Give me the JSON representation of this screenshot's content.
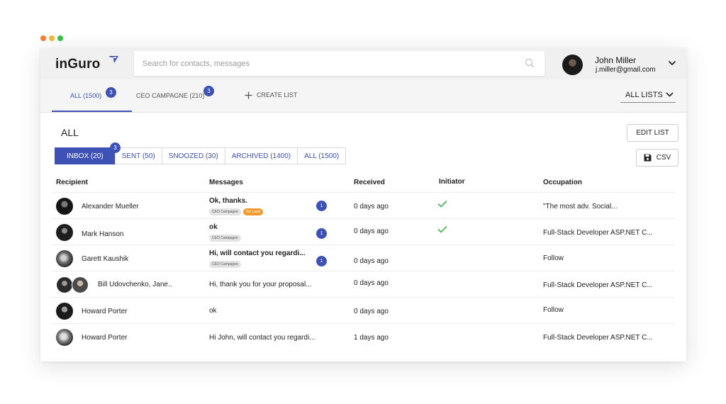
{
  "window": {
    "dots": [
      "#f57d3b",
      "#f5b93b",
      "#3bc24a"
    ]
  },
  "header": {
    "logo": "inGuro",
    "search_placeholder": "Search for contacts, messages",
    "user": {
      "name": "John Miller",
      "email": "j.miller@gmail.com"
    }
  },
  "tabs": [
    {
      "label": "ALL (1500)",
      "badge": "3",
      "active": true
    },
    {
      "label": "CEO CAMPAGNE (210)",
      "badge": "3",
      "active": false
    }
  ],
  "create_list": "CREATE LIST",
  "list_selector": "ALL LISTS",
  "page_title": "ALL",
  "edit_list": "EDIT LIST",
  "csv": "CSV",
  "filters": [
    {
      "label": "INBOX (20)",
      "badge": "3",
      "active": true
    },
    {
      "label": "SENT (50)",
      "active": false
    },
    {
      "label": "SNOOZED (30)",
      "active": false
    },
    {
      "label": "ARCHIVED (1400)",
      "active": false
    },
    {
      "label": "ALL (1500)",
      "active": false
    }
  ],
  "table": {
    "columns": [
      "Recipient",
      "Messages",
      "Received",
      "Initiator",
      "Occupation"
    ],
    "rows": [
      {
        "recipient": "Alexander Mueller",
        "message": "Ok, thanks.",
        "unread": true,
        "tags": [
          "CEO Campagne",
          "Hot Lead"
        ],
        "count": "1",
        "received": "0 days ago",
        "initiator": true,
        "occupation": "\"The most adv. Social..."
      },
      {
        "recipient": "Mark Hanson",
        "message": "ok",
        "unread": true,
        "tags": [
          "CEO Campagne"
        ],
        "count": "1",
        "received": "0 days ago",
        "initiator": true,
        "occupation": "Full-Stack Developer ASP.NET C..."
      },
      {
        "recipient": "Garett Kaushik",
        "message": "Hi, will contact you regardi...",
        "unread": true,
        "tags": [
          "CEO Campagne"
        ],
        "count": "1",
        "received": "0 days ago",
        "initiator": false,
        "occupation": "Follow"
      },
      {
        "recipient": "Bill Udovchenko, Jane..",
        "message": "Hi,  thank you for your proposal...",
        "unread": false,
        "tags": [],
        "received": "0 days ago",
        "initiator": false,
        "occupation": "Full-Stack Developer ASP.NET C..."
      },
      {
        "recipient": "Howard Porter",
        "message": "ok",
        "unread": false,
        "tags": [],
        "received": "0 days ago",
        "initiator": false,
        "occupation": "Follow"
      },
      {
        "recipient": "Howard Porter",
        "message": "Hi John, will contact you regardi...",
        "unread": false,
        "tags": [],
        "received": "1 days ago",
        "initiator": false,
        "occupation": "Full-Stack Developer ASP.NET C..."
      }
    ]
  }
}
